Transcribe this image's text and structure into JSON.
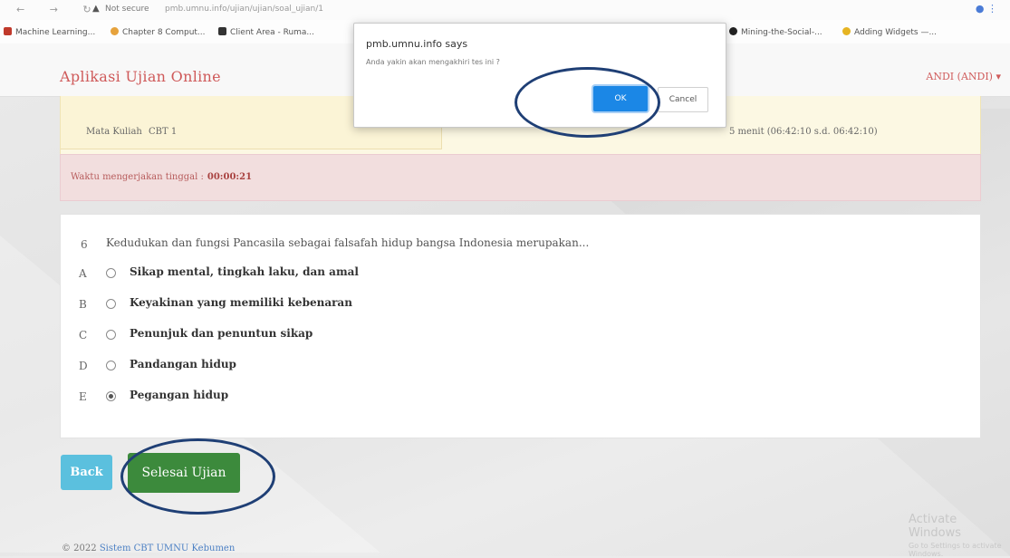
{
  "browser": {
    "site_label": "Not secure",
    "url": "pmb.umnu.info/ujian/ujian/soal_ujian/1",
    "bookmarks": [
      {
        "label": "Machine Learning...",
        "color": "#c0392b"
      },
      {
        "label": "Chapter 8 Comput...",
        "color": "#e6a23c"
      },
      {
        "label": "Client Area - Ruma...",
        "color": "#333333"
      },
      {
        "label": "Mining-the-Social-...",
        "color": "#222222"
      },
      {
        "label": "Adding Widgets —...",
        "color": "#e6b422"
      }
    ]
  },
  "navbar": {
    "brand": "Aplikasi Ujian Online",
    "user": "ANDI (ANDI) ▾"
  },
  "info": {
    "label": "Mata Kuliah",
    "value": "CBT 1",
    "time": "5 menit (06:42:10 s.d. 06:42:10)"
  },
  "alert": {
    "text": "Waktu mengerjakan tinggal :",
    "timer": "00:00:21"
  },
  "question": {
    "number": "6",
    "text": "Kedudukan dan fungsi Pancasila sebagai falsafah hidup bangsa Indonesia merupakan...",
    "options": [
      {
        "letter": "A",
        "text": "Sikap mental, tingkah laku, dan amal",
        "selected": false
      },
      {
        "letter": "B",
        "text": "Keyakinan yang memiliki kebenaran",
        "selected": false
      },
      {
        "letter": "C",
        "text": "Penunjuk dan penuntun sikap",
        "selected": false
      },
      {
        "letter": "D",
        "text": "Pandangan hidup",
        "selected": false
      },
      {
        "letter": "E",
        "text": "Pegangan hidup",
        "selected": true
      }
    ]
  },
  "buttons": {
    "back": "Back",
    "finish": "Selesai Ujian"
  },
  "footer": {
    "copyright": "© 2022",
    "link": "Sistem CBT UMNU Kebumen"
  },
  "watermark": {
    "line1": "Activate Windows",
    "line2": "Go to Settings to activate Windows."
  },
  "dialog": {
    "title": "pmb.umnu.info says",
    "message": "Anda yakin akan mengakhiri tes ini ?",
    "ok": "OK",
    "cancel": "Cancel"
  },
  "colors": {
    "brand": "#cf5a5a",
    "finish_button": "#3c8a3c",
    "back_button": "#5bc0de",
    "highlight_circle": "#1f3f75",
    "ok_button": "#1b87e6"
  }
}
